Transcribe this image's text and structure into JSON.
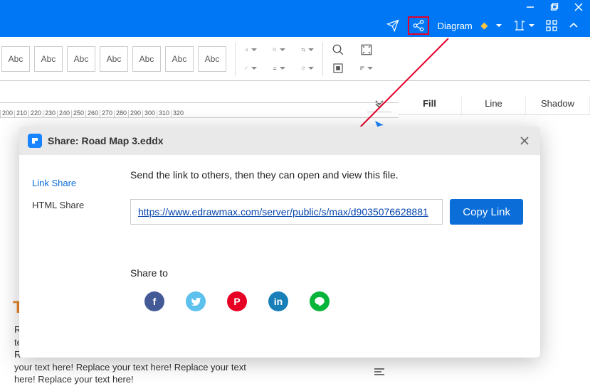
{
  "window": {
    "min": "–",
    "restore": "❐",
    "close": "✕"
  },
  "menubar": {
    "diagram_label": "Diagram"
  },
  "toolbar": {
    "abc_label": "Abc"
  },
  "props_tabs": {
    "fill": "Fill",
    "line": "Line",
    "shadow": "Shadow"
  },
  "ruler": [
    "200",
    "210",
    "220",
    "230",
    "240",
    "250",
    "260",
    "270",
    "280",
    "290",
    "300",
    "310",
    "320"
  ],
  "dialog": {
    "title": "Share: Road Map 3.eddx",
    "side": {
      "link_share": "Link Share",
      "html_share": "HTML Share"
    },
    "desc": "Send the link to others, then they can open and view this file.",
    "url": "https://www.edrawmax.com/server/public/s/max/d9035076628881",
    "copy": "Copy Link",
    "share_to": "Share to"
  },
  "bg": {
    "t": "T",
    "r_prefix": "R",
    "line1": "your text here! Replace your text here!  Replace your text",
    "line2": "here! Replace your text here!"
  }
}
